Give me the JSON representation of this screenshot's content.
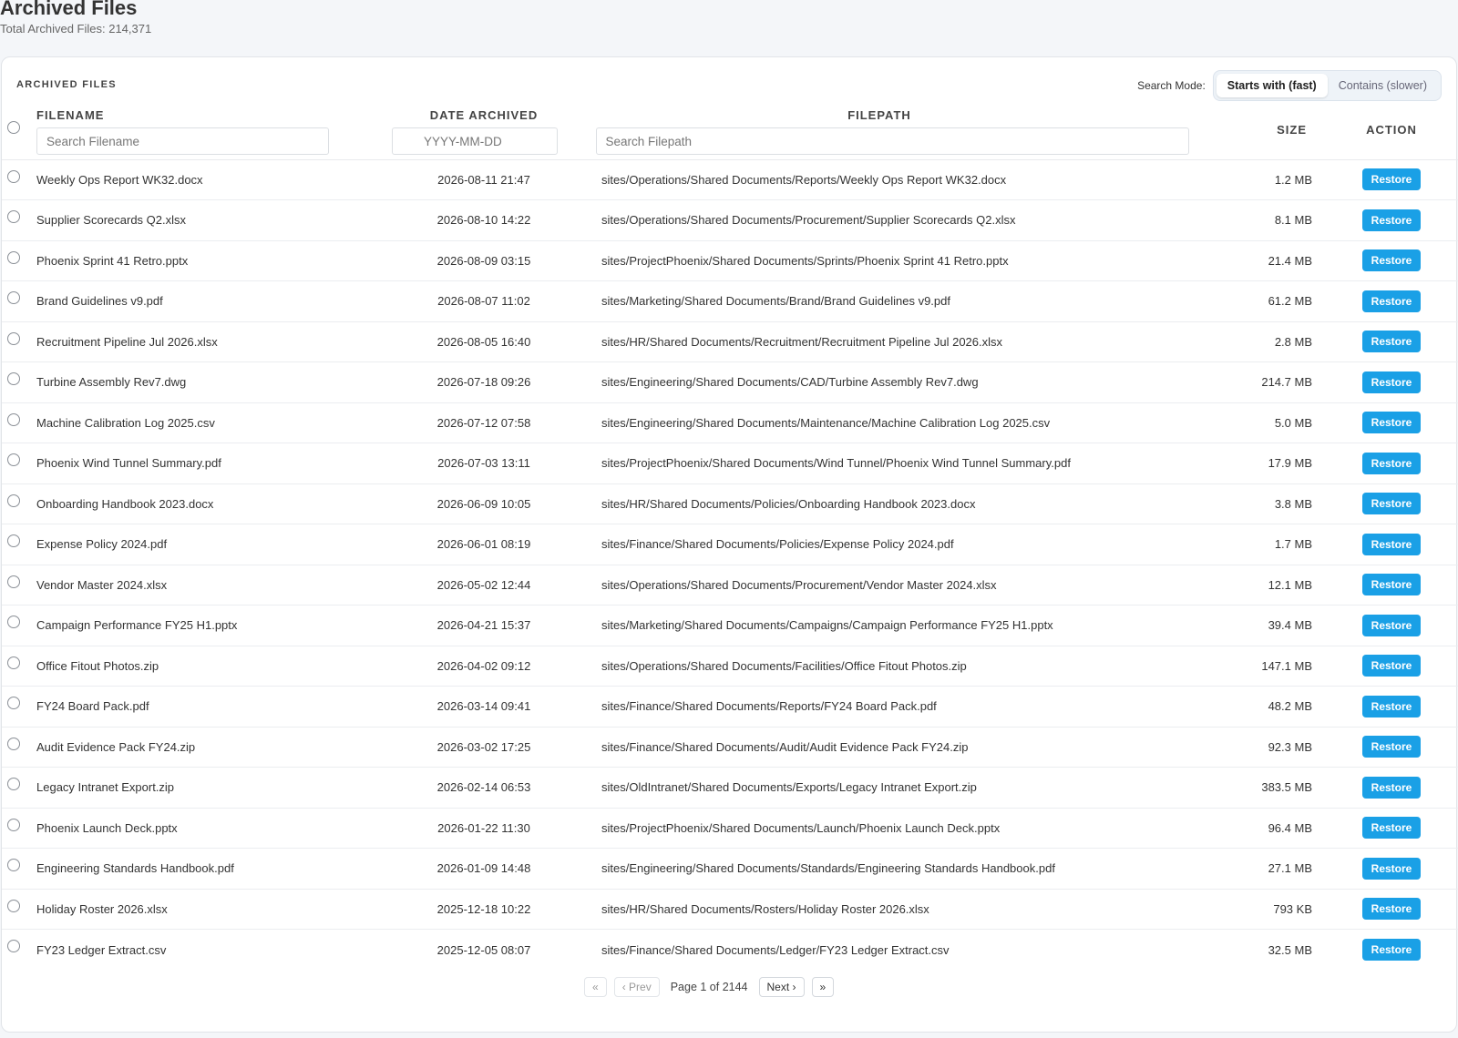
{
  "header": {
    "title": "Archived Files",
    "subtitle": "Total Archived Files: 214,371"
  },
  "card": {
    "title": "ARCHIVED FILES",
    "search_mode_label": "Search Mode:",
    "search_modes": [
      {
        "label": "Starts with (fast)",
        "active": true
      },
      {
        "label": "Contains (slower)",
        "active": false
      }
    ]
  },
  "columns": {
    "filename": "FILENAME",
    "date": "DATE ARCHIVED",
    "filepath": "FILEPATH",
    "size": "SIZE",
    "action": "ACTION"
  },
  "filters": {
    "filename_placeholder": "Search Filename",
    "date_placeholder": "YYYY-MM-DD",
    "filepath_placeholder": "Search Filepath"
  },
  "action_label": "Restore",
  "rows": [
    {
      "filename": "Weekly Ops Report WK32.docx",
      "date": "2026-08-11 21:47",
      "path": "sites/Operations/Shared Documents/Reports/Weekly Ops Report WK32.docx",
      "size": "1.2 MB"
    },
    {
      "filename": "Supplier Scorecards Q2.xlsx",
      "date": "2026-08-10 14:22",
      "path": "sites/Operations/Shared Documents/Procurement/Supplier Scorecards Q2.xlsx",
      "size": "8.1 MB"
    },
    {
      "filename": "Phoenix Sprint 41 Retro.pptx",
      "date": "2026-08-09 03:15",
      "path": "sites/ProjectPhoenix/Shared Documents/Sprints/Phoenix Sprint 41 Retro.pptx",
      "size": "21.4 MB"
    },
    {
      "filename": "Brand Guidelines v9.pdf",
      "date": "2026-08-07 11:02",
      "path": "sites/Marketing/Shared Documents/Brand/Brand Guidelines v9.pdf",
      "size": "61.2 MB"
    },
    {
      "filename": "Recruitment Pipeline Jul 2026.xlsx",
      "date": "2026-08-05 16:40",
      "path": "sites/HR/Shared Documents/Recruitment/Recruitment Pipeline Jul 2026.xlsx",
      "size": "2.8 MB"
    },
    {
      "filename": "Turbine Assembly Rev7.dwg",
      "date": "2026-07-18 09:26",
      "path": "sites/Engineering/Shared Documents/CAD/Turbine Assembly Rev7.dwg",
      "size": "214.7 MB"
    },
    {
      "filename": "Machine Calibration Log 2025.csv",
      "date": "2026-07-12 07:58",
      "path": "sites/Engineering/Shared Documents/Maintenance/Machine Calibration Log 2025.csv",
      "size": "5.0 MB"
    },
    {
      "filename": "Phoenix Wind Tunnel Summary.pdf",
      "date": "2026-07-03 13:11",
      "path": "sites/ProjectPhoenix/Shared Documents/Wind Tunnel/Phoenix Wind Tunnel Summary.pdf",
      "size": "17.9 MB"
    },
    {
      "filename": "Onboarding Handbook 2023.docx",
      "date": "2026-06-09 10:05",
      "path": "sites/HR/Shared Documents/Policies/Onboarding Handbook 2023.docx",
      "size": "3.8 MB"
    },
    {
      "filename": "Expense Policy 2024.pdf",
      "date": "2026-06-01 08:19",
      "path": "sites/Finance/Shared Documents/Policies/Expense Policy 2024.pdf",
      "size": "1.7 MB"
    },
    {
      "filename": "Vendor Master 2024.xlsx",
      "date": "2026-05-02 12:44",
      "path": "sites/Operations/Shared Documents/Procurement/Vendor Master 2024.xlsx",
      "size": "12.1 MB"
    },
    {
      "filename": "Campaign Performance FY25 H1.pptx",
      "date": "2026-04-21 15:37",
      "path": "sites/Marketing/Shared Documents/Campaigns/Campaign Performance FY25 H1.pptx",
      "size": "39.4 MB"
    },
    {
      "filename": "Office Fitout Photos.zip",
      "date": "2026-04-02 09:12",
      "path": "sites/Operations/Shared Documents/Facilities/Office Fitout Photos.zip",
      "size": "147.1 MB"
    },
    {
      "filename": "FY24 Board Pack.pdf",
      "date": "2026-03-14 09:41",
      "path": "sites/Finance/Shared Documents/Reports/FY24 Board Pack.pdf",
      "size": "48.2 MB"
    },
    {
      "filename": "Audit Evidence Pack FY24.zip",
      "date": "2026-03-02 17:25",
      "path": "sites/Finance/Shared Documents/Audit/Audit Evidence Pack FY24.zip",
      "size": "92.3 MB"
    },
    {
      "filename": "Legacy Intranet Export.zip",
      "date": "2026-02-14 06:53",
      "path": "sites/OldIntranet/Shared Documents/Exports/Legacy Intranet Export.zip",
      "size": "383.5 MB"
    },
    {
      "filename": "Phoenix Launch Deck.pptx",
      "date": "2026-01-22 11:30",
      "path": "sites/ProjectPhoenix/Shared Documents/Launch/Phoenix Launch Deck.pptx",
      "size": "96.4 MB"
    },
    {
      "filename": "Engineering Standards Handbook.pdf",
      "date": "2026-01-09 14:48",
      "path": "sites/Engineering/Shared Documents/Standards/Engineering Standards Handbook.pdf",
      "size": "27.1 MB"
    },
    {
      "filename": "Holiday Roster 2026.xlsx",
      "date": "2025-12-18 10:22",
      "path": "sites/HR/Shared Documents/Rosters/Holiday Roster 2026.xlsx",
      "size": "793 KB"
    },
    {
      "filename": "FY23 Ledger Extract.csv",
      "date": "2025-12-05 08:07",
      "path": "sites/Finance/Shared Documents/Ledger/FY23 Ledger Extract.csv",
      "size": "32.5 MB"
    }
  ],
  "pagination": {
    "first": "«",
    "prev": "‹ Prev",
    "info": "Page 1 of 2144",
    "next": "Next ›",
    "last": "»"
  }
}
